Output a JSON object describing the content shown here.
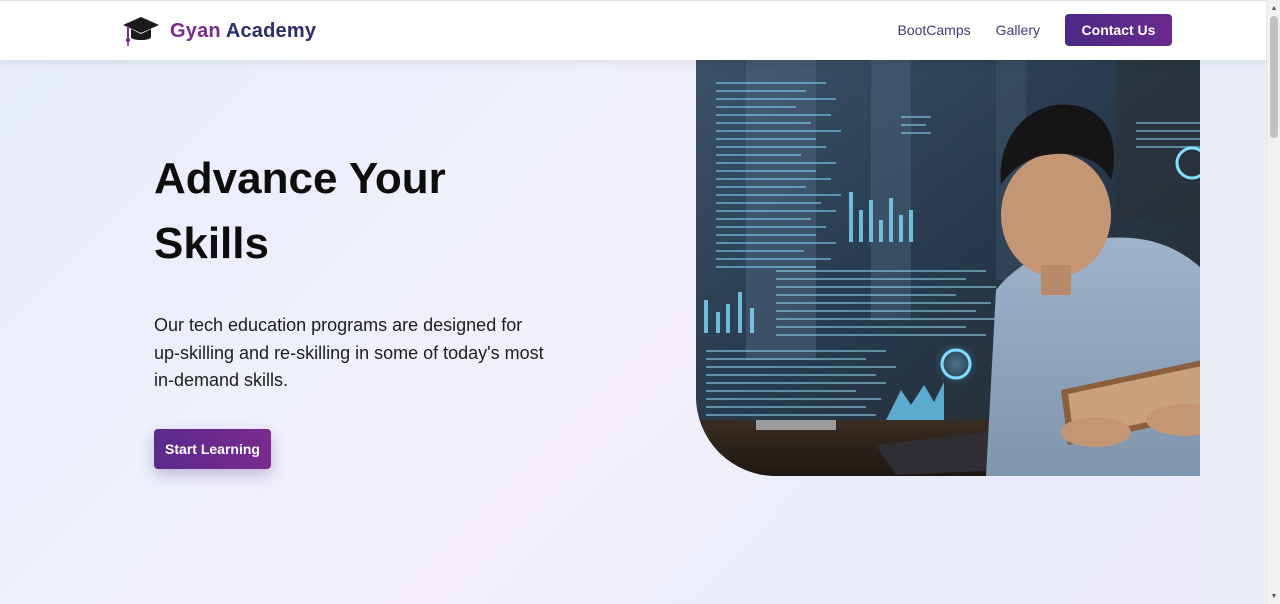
{
  "header": {
    "brand_first": "Gyan",
    "brand_second": "Academy",
    "nav": [
      {
        "label": "BootCamps"
      },
      {
        "label": "Gallery"
      }
    ],
    "contact_label": "Contact Us"
  },
  "hero": {
    "title": "Advance Your Skills",
    "description": "Our tech education programs are designed for up-skilling and re-skilling in some of today's most in-demand skills.",
    "cta_label": "Start Learning",
    "image_icon": "person-with-tablet-and-laptop-hologram-photo"
  },
  "icons": {
    "brand": "graduation-cap-icon",
    "scroll_up": "scroll-up-arrow-icon",
    "scroll_down": "scroll-down-arrow-icon"
  },
  "colors": {
    "brand_purple": "#7a2a8e",
    "brand_navy": "#2b2e6e",
    "button_gradient_start": "#4a2a86",
    "button_gradient_end": "#6a2a8c",
    "hologram_cyan": "#5fd0ff"
  }
}
